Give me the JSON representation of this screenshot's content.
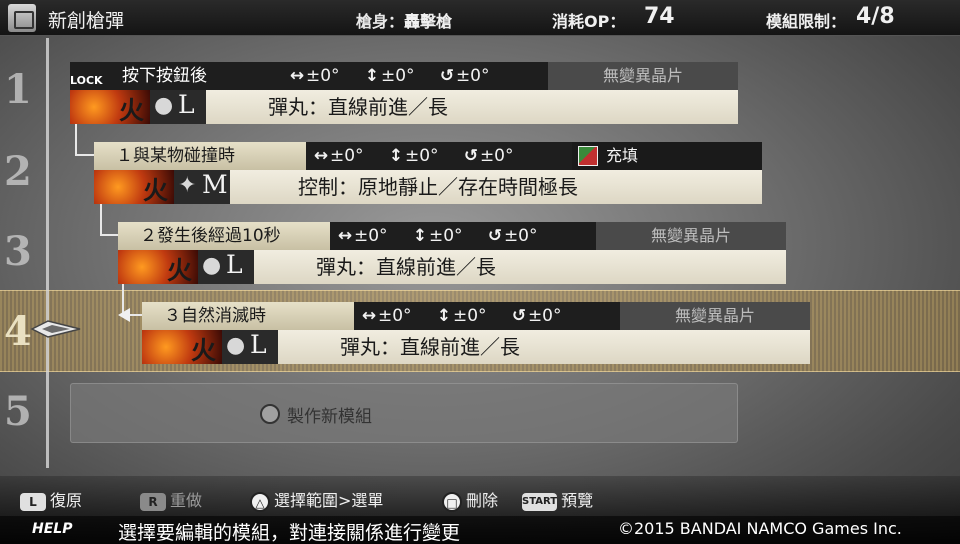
{
  "header": {
    "title": "新創槍彈",
    "gun_label": "槍身：",
    "gun_value": "轟擊槍",
    "op_label": "消耗OP：",
    "op_value": "74",
    "limit_label": "模組限制：",
    "limit_value": "4/8"
  },
  "row_numbers": [
    "1",
    "2",
    "3",
    "4",
    "5"
  ],
  "modules": [
    {
      "lock": "LOCK",
      "condition": "按下按鈕後",
      "params": [
        "±0°",
        "±0°",
        "±0°"
      ],
      "crystal": "無變異晶片",
      "element": "火",
      "size": "L",
      "description": "彈丸：直線前進／長"
    },
    {
      "condition": "１與某物碰撞時",
      "params": [
        "±0°",
        "±0°",
        "±0°"
      ],
      "crystal": "充填",
      "element": "火",
      "size": "M",
      "description": "控制：原地靜止／存在時間極長"
    },
    {
      "condition": "２發生後經過10秒",
      "params": [
        "±0°",
        "±0°",
        "±0°"
      ],
      "crystal": "無變異晶片",
      "element": "火",
      "size": "L",
      "description": "彈丸：直線前進／長"
    },
    {
      "condition": "３自然消滅時",
      "params": [
        "±0°",
        "±0°",
        "±0°"
      ],
      "crystal": "無變異晶片",
      "element": "火",
      "size": "L",
      "description": "彈丸：直線前進／長"
    }
  ],
  "new_module": {
    "label": "製作新模組"
  },
  "footer": {
    "buttons": [
      {
        "key": "L",
        "label": "復原"
      },
      {
        "key": "R",
        "label": "重做"
      },
      {
        "key": "△",
        "label": "選擇範圍>選單"
      },
      {
        "key": "□",
        "label": "刪除"
      },
      {
        "key": "START",
        "label": "預覽"
      }
    ],
    "help_tag": "HELP",
    "help_text": "選擇要編輯的模組，對連接關係進行變更",
    "copyright": "©2015 BANDAI NAMCO Games Inc."
  },
  "colors": {
    "selection": "#c8a55a",
    "panel_light": "#e6e0c8",
    "panel_dark": "#1e1e1e"
  }
}
